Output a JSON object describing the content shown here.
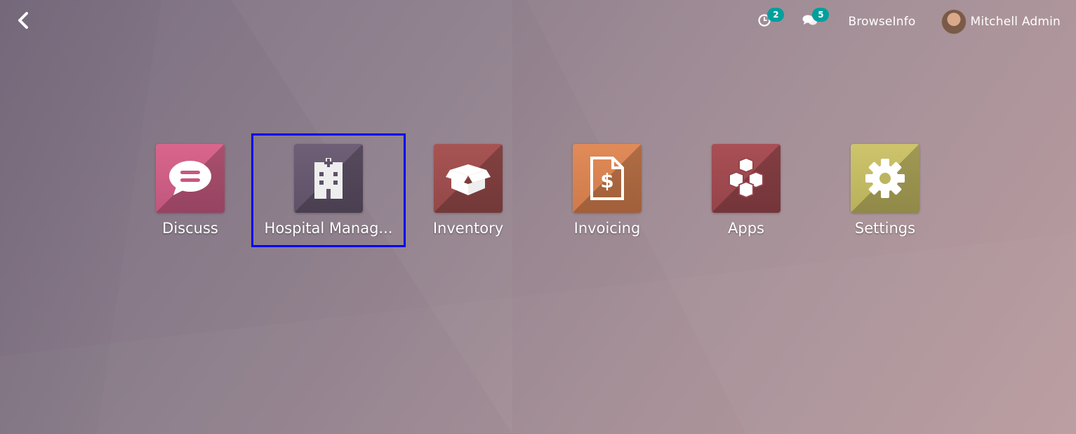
{
  "systray": {
    "activity_count": "2",
    "message_count": "5",
    "company": "BrowseInfo",
    "user_name": "Mitchell Admin"
  },
  "apps": [
    {
      "label": "Discuss",
      "icon": "discuss-icon",
      "color_top": "#d9668c",
      "color_bottom": "#c0567c"
    },
    {
      "label": "Hospital Manag...",
      "icon": "hospital-icon",
      "color_top": "#6e5f76",
      "color_bottom": "#5f5168",
      "selected": true
    },
    {
      "label": "Inventory",
      "icon": "box-icon",
      "color_top": "#a85353",
      "color_bottom": "#934848"
    },
    {
      "label": "Invoicing",
      "icon": "invoice-icon",
      "color_top": "#e08b58",
      "color_bottom": "#cf7a4a"
    },
    {
      "label": "Apps",
      "icon": "cubes-icon",
      "color_top": "#a94f55",
      "color_bottom": "#94444a"
    },
    {
      "label": "Settings",
      "icon": "gear-icon",
      "color_top": "#cdc46c",
      "color_bottom": "#b9b05c"
    }
  ],
  "selection_outline_color": "#0000ff"
}
